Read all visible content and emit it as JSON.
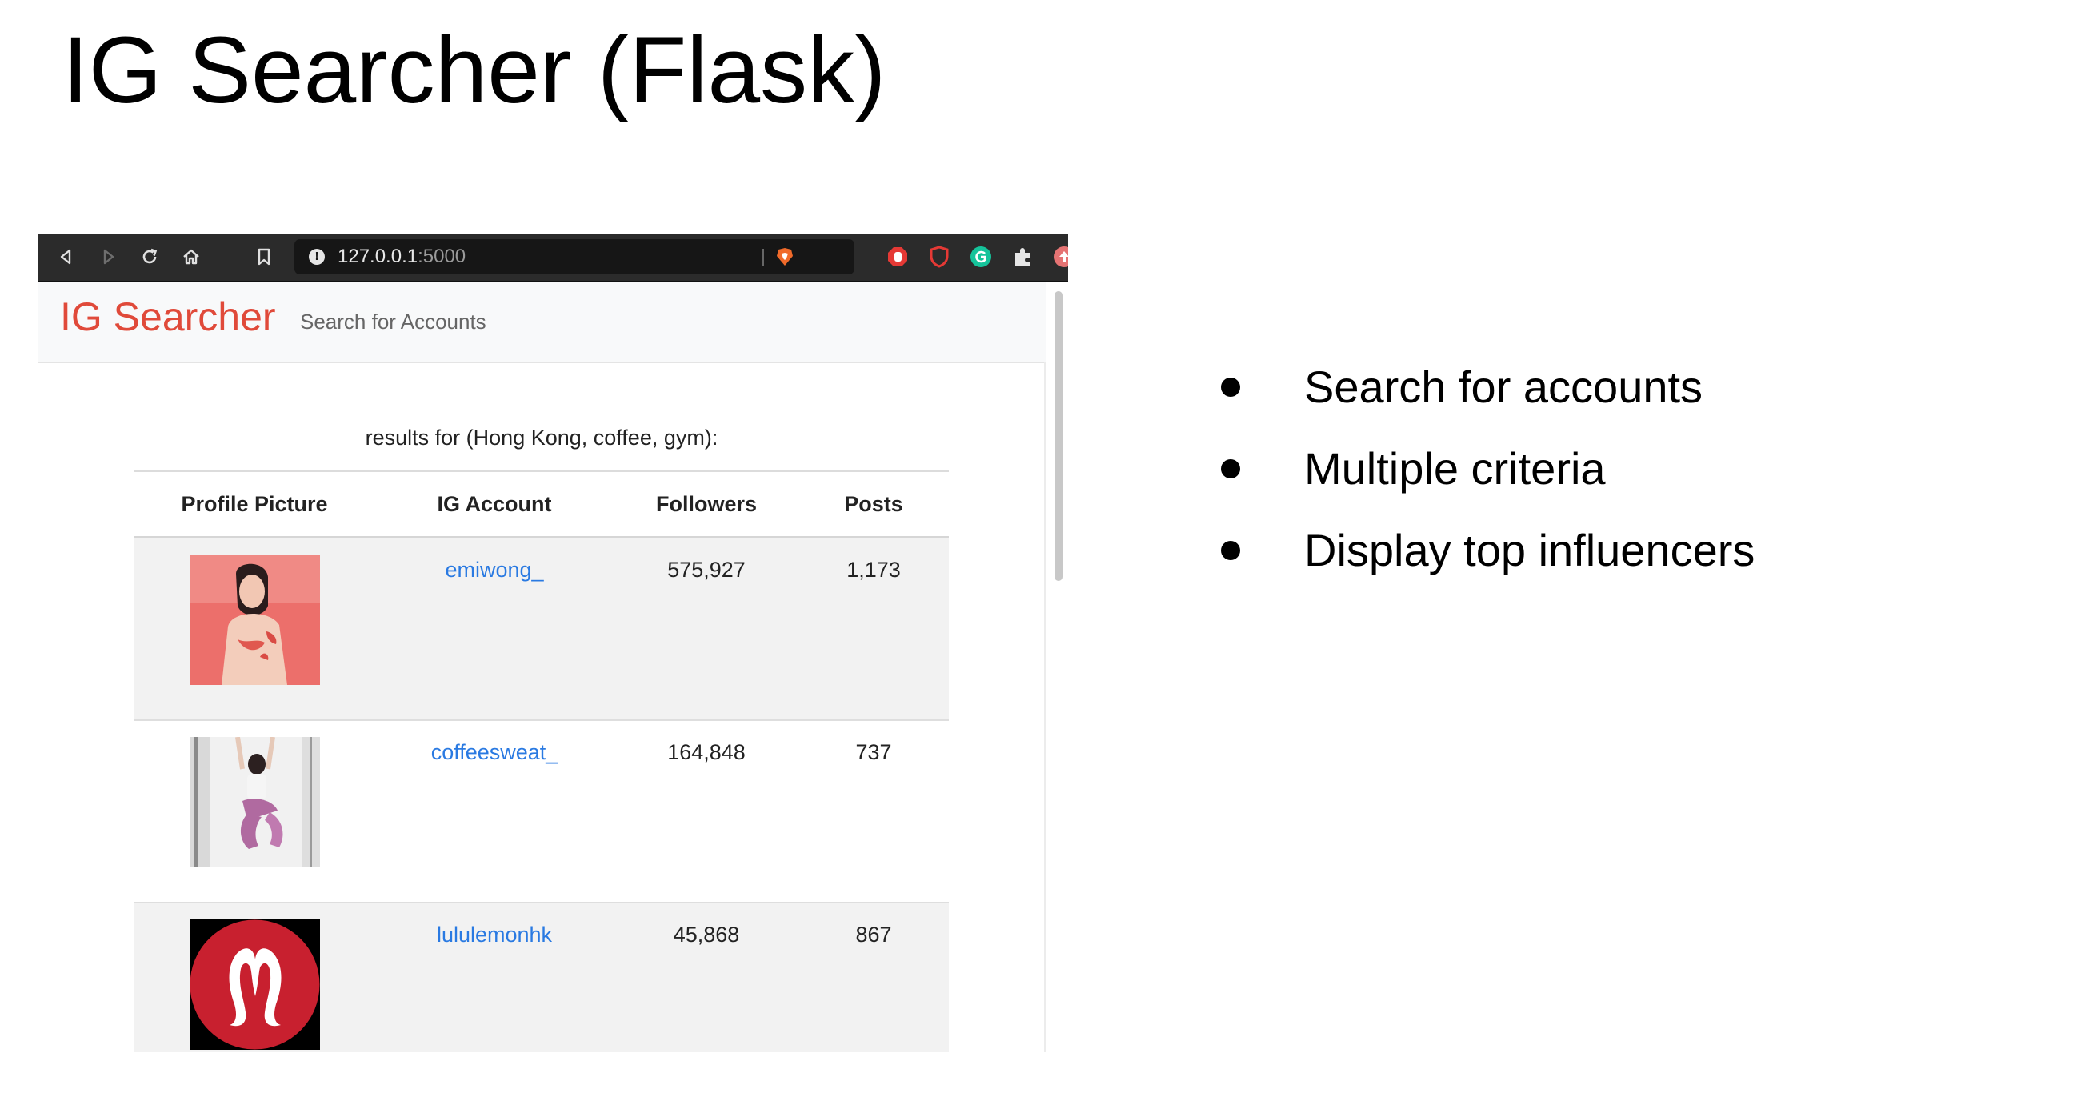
{
  "slide": {
    "title": "IG Searcher (Flask)",
    "bullets": [
      "Search for accounts",
      "Multiple criteria",
      "Display top influencers"
    ]
  },
  "browser": {
    "url_host": "127.0.0.1",
    "url_port": ":5000",
    "toolbar_icons": [
      "back-icon",
      "forward-icon",
      "reload-icon",
      "home-icon",
      "bookmark-icon"
    ],
    "extension_icons": [
      "stop-hand-icon",
      "shield-icon",
      "grammarly-icon",
      "puzzle-icon",
      "upload-icon"
    ]
  },
  "app": {
    "brand": "IG Searcher",
    "nav_link": "Search for Accounts",
    "brand_color": "#e04a3a",
    "link_color": "#2a7ae2",
    "results_caption": "results for (Hong Kong, coffee, gym):",
    "columns": [
      "Profile Picture",
      "IG Account",
      "Followers",
      "Posts"
    ],
    "rows": [
      {
        "account": "emiwong_",
        "followers": "575,927",
        "posts": "1,173"
      },
      {
        "account": "coffeesweat_",
        "followers": "164,848",
        "posts": "737"
      },
      {
        "account": "lululemonhk",
        "followers": "45,868",
        "posts": "867"
      }
    ]
  }
}
